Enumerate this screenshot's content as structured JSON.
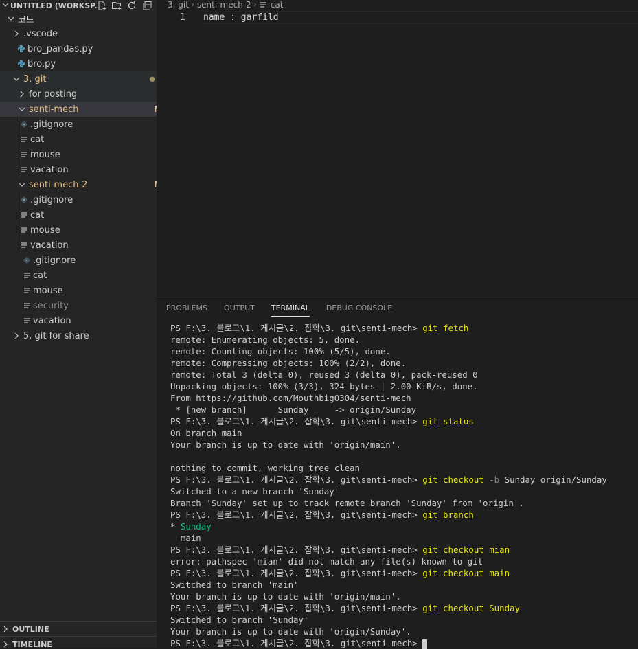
{
  "explorer": {
    "workspace_title": "UNTITLED (WORKSP...",
    "actions": [
      "new-file-icon",
      "new-folder-icon",
      "refresh-icon",
      "collapse-all-icon"
    ]
  },
  "tree": [
    {
      "label": "코드",
      "depth": 0,
      "kind": "folder-open"
    },
    {
      "label": ".vscode",
      "depth": 1,
      "kind": "folder-closed"
    },
    {
      "label": "bro_pandas.py",
      "depth": 1,
      "kind": "python"
    },
    {
      "label": "bro.py",
      "depth": 1,
      "kind": "python"
    },
    {
      "label": "3. git",
      "depth": 1,
      "kind": "folder-open",
      "badge": "●",
      "modified": true
    },
    {
      "label": "for posting",
      "depth": 2,
      "kind": "folder-closed"
    },
    {
      "label": "senti-mech",
      "depth": 2,
      "kind": "folder-open",
      "badge": "M",
      "modified": true
    },
    {
      "label": ".gitignore",
      "depth": 3,
      "kind": "git"
    },
    {
      "label": "cat",
      "depth": 3,
      "kind": "text"
    },
    {
      "label": "mouse",
      "depth": 3,
      "kind": "text"
    },
    {
      "label": "vacation",
      "depth": 3,
      "kind": "text"
    },
    {
      "label": "senti-mech-2",
      "depth": 2,
      "kind": "folder-open",
      "badge": "M",
      "modified": true
    },
    {
      "label": ".gitignore",
      "depth": 3,
      "kind": "git"
    },
    {
      "label": "cat",
      "depth": 3,
      "kind": "text"
    },
    {
      "label": "mouse",
      "depth": 3,
      "kind": "text"
    },
    {
      "label": "vacation",
      "depth": 3,
      "kind": "text"
    },
    {
      "label": ".gitignore",
      "depth": 2,
      "kind": "git"
    },
    {
      "label": "cat",
      "depth": 2,
      "kind": "text"
    },
    {
      "label": "mouse",
      "depth": 2,
      "kind": "text"
    },
    {
      "label": "security",
      "depth": 2,
      "kind": "text",
      "dimmed": true
    },
    {
      "label": "vacation",
      "depth": 2,
      "kind": "text"
    },
    {
      "label": "5. git for share",
      "depth": 1,
      "kind": "folder-closed"
    }
  ],
  "sections": {
    "outline": "OUTLINE",
    "timeline": "TIMELINE"
  },
  "editor": {
    "breadcrumb": [
      "3. git",
      "senti-mech-2",
      "cat"
    ],
    "line_number": "1",
    "line_text": "name : garfild"
  },
  "panel": {
    "tabs": [
      "PROBLEMS",
      "OUTPUT",
      "TERMINAL",
      "DEBUG CONSOLE"
    ],
    "active_tab": "TERMINAL"
  },
  "terminal": {
    "prompt": "PS F:\\3. 블로그\\1. 게시글\\2. 잡학\\3. git\\senti-mech>",
    "lines": [
      {
        "t": "cmd",
        "cmd": "git fetch"
      },
      {
        "t": "out",
        "text": "remote: Enumerating objects: 5, done."
      },
      {
        "t": "out",
        "text": "remote: Counting objects: 100% (5/5), done."
      },
      {
        "t": "out",
        "text": "remote: Compressing objects: 100% (2/2), done."
      },
      {
        "t": "out",
        "text": "remote: Total 3 (delta 0), reused 3 (delta 0), pack-reused 0"
      },
      {
        "t": "out",
        "text": "Unpacking objects: 100% (3/3), 324 bytes | 2.00 KiB/s, done."
      },
      {
        "t": "out",
        "text": "From https://github.com/Mouthbig0304/senti-mech"
      },
      {
        "t": "out",
        "text": " * [new branch]      Sunday     -> origin/Sunday"
      },
      {
        "t": "cmd",
        "cmd": "git status"
      },
      {
        "t": "out",
        "text": "On branch main"
      },
      {
        "t": "out",
        "text": "Your branch is up to date with 'origin/main'."
      },
      {
        "t": "out",
        "text": ""
      },
      {
        "t": "out",
        "text": "nothing to commit, working tree clean"
      },
      {
        "t": "cmd",
        "cmd": "git checkout",
        "flag": "-b",
        "rest": "Sunday origin/Sunday"
      },
      {
        "t": "out",
        "text": "Switched to a new branch 'Sunday'"
      },
      {
        "t": "out",
        "text": "Branch 'Sunday' set up to track remote branch 'Sunday' from 'origin'."
      },
      {
        "t": "cmd",
        "cmd": "git branch"
      },
      {
        "t": "branch",
        "marker": "* ",
        "text": "Sunday",
        "current": true
      },
      {
        "t": "out",
        "text": "  main"
      },
      {
        "t": "cmd",
        "cmd": "git checkout mian"
      },
      {
        "t": "out",
        "text": "error: pathspec 'mian' did not match any file(s) known to git"
      },
      {
        "t": "cmd",
        "cmd": "git checkout main"
      },
      {
        "t": "out",
        "text": "Switched to branch 'main'"
      },
      {
        "t": "out",
        "text": "Your branch is up to date with 'origin/main'."
      },
      {
        "t": "cmd",
        "cmd": "git checkout Sunday"
      },
      {
        "t": "out",
        "text": "Switched to branch 'Sunday'"
      },
      {
        "t": "out",
        "text": "Your branch is up to date with 'origin/Sunday'."
      },
      {
        "t": "prompt-cursor"
      }
    ]
  },
  "colors": {
    "modified": "#e2c08d",
    "command": "#e5e510",
    "branch_current": "#0dbc79",
    "python_icon": "#519aba"
  }
}
